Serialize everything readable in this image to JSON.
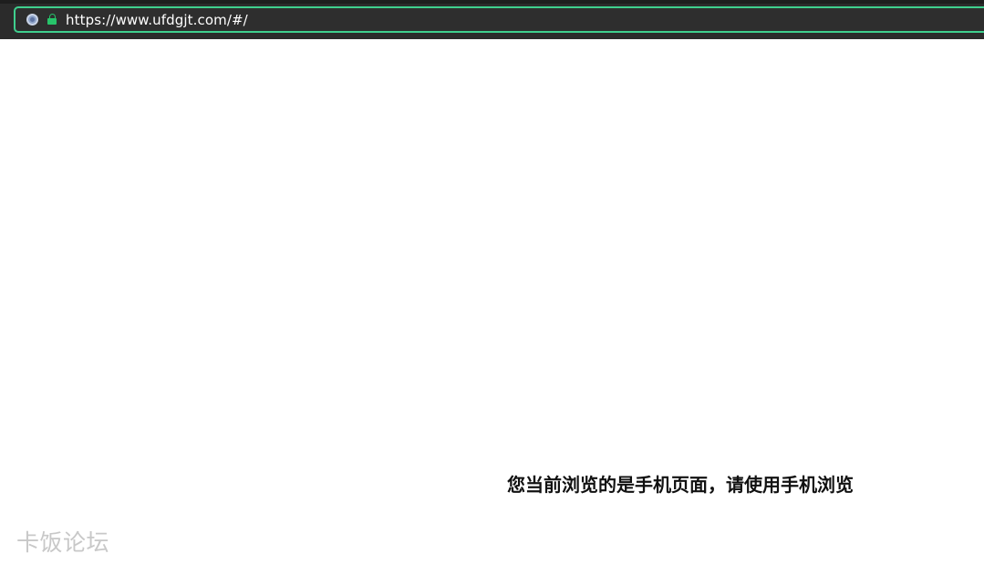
{
  "browser": {
    "address_bar": {
      "url": "https://www.ufdgjt.com/#/",
      "site_icon": "globe-icon",
      "secure_icon": "lock-icon",
      "accent_color": "#3fcf8e",
      "lock_color": "#27c46a"
    }
  },
  "page": {
    "notice_text": "您当前浏览的是手机页面，请使用手机浏览",
    "watermark": "卡饭论坛"
  }
}
